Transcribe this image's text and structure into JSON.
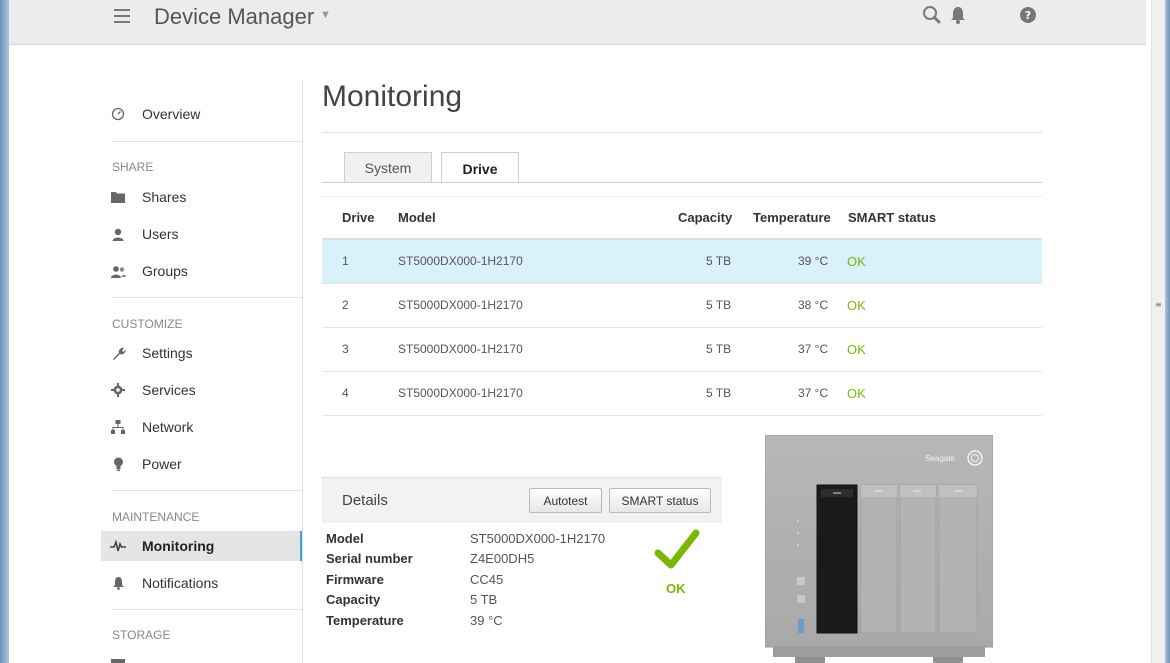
{
  "header": {
    "title": "Device Manager"
  },
  "sidebar": {
    "overview": "Overview",
    "sections": {
      "share": "SHARE",
      "customize": "CUSTOMIZE",
      "maintenance": "MAINTENANCE",
      "storage": "STORAGE"
    },
    "items": {
      "shares": "Shares",
      "users": "Users",
      "groups": "Groups",
      "settings": "Settings",
      "services": "Services",
      "network": "Network",
      "power": "Power",
      "monitoring": "Monitoring",
      "notifications": "Notifications"
    }
  },
  "page": {
    "title": "Monitoring",
    "tabs": [
      "System",
      "Drive"
    ],
    "active_tab": "Drive"
  },
  "table": {
    "columns": [
      "Drive",
      "Model",
      "Capacity",
      "Temperature",
      "SMART status"
    ],
    "rows": [
      {
        "drive": "1",
        "model": "ST5000DX000-1H2170",
        "capacity": "5 TB",
        "temperature": "39 °C",
        "smart": "OK"
      },
      {
        "drive": "2",
        "model": "ST5000DX000-1H2170",
        "capacity": "5 TB",
        "temperature": "38 °C",
        "smart": "OK"
      },
      {
        "drive": "3",
        "model": "ST5000DX000-1H2170",
        "capacity": "5 TB",
        "temperature": "37 °C",
        "smart": "OK"
      },
      {
        "drive": "4",
        "model": "ST5000DX000-1H2170",
        "capacity": "5 TB",
        "temperature": "37 °C",
        "smart": "OK"
      }
    ],
    "selected_row": 1
  },
  "details": {
    "title": "Details",
    "autotest_label": "Autotest",
    "smart_label": "SMART status",
    "fields": [
      {
        "label": "Model",
        "value": "ST5000DX000-1H2170"
      },
      {
        "label": "Serial number",
        "value": "Z4E00DH5"
      },
      {
        "label": "Firmware",
        "value": "CC45"
      },
      {
        "label": "Capacity",
        "value": "5 TB"
      },
      {
        "label": "Temperature",
        "value": "39 °C"
      }
    ],
    "status": "OK"
  },
  "device": {
    "brand": "Seagate"
  },
  "colors": {
    "ok_green": "#7ab800",
    "accent_blue": "#33a6de",
    "selected_row": "#d9f1fb"
  }
}
